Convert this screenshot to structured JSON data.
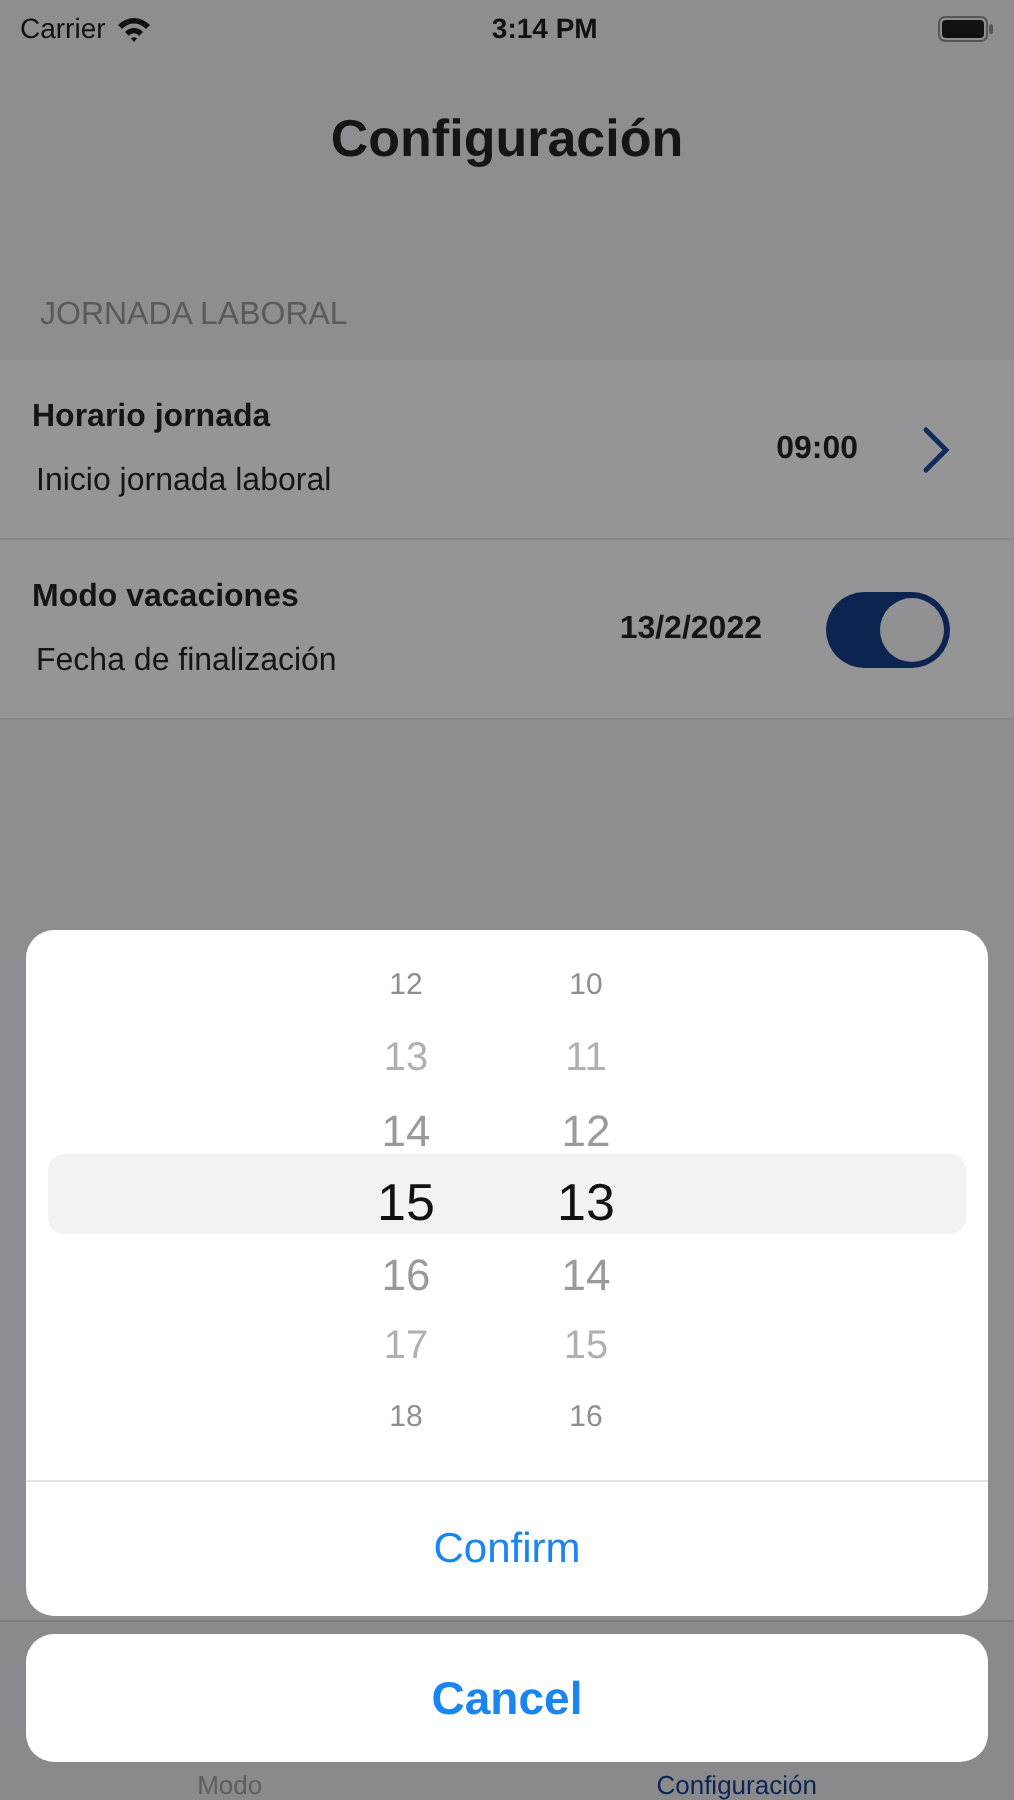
{
  "status_bar": {
    "carrier": "Carrier",
    "time": "3:14 PM"
  },
  "title": "Configuración",
  "section": {
    "header": "JORNADA LABORAL",
    "rows": [
      {
        "kind": "link",
        "title": "Horario jornada",
        "subtitle": "Inicio jornada laboral",
        "value": "09:00"
      },
      {
        "kind": "toggle",
        "title": "Modo vacaciones",
        "subtitle": "Fecha de finalización",
        "value": "13/2/2022",
        "on": true
      }
    ]
  },
  "picker": {
    "columns": [
      {
        "items": [
          {
            "label": "12",
            "selected": false
          },
          {
            "label": "13",
            "selected": false
          },
          {
            "label": "14",
            "selected": false
          },
          {
            "label": "15",
            "selected": true
          },
          {
            "label": "16",
            "selected": false
          },
          {
            "label": "17",
            "selected": false
          },
          {
            "label": "18",
            "selected": false
          }
        ]
      },
      {
        "items": [
          {
            "label": "10",
            "selected": false
          },
          {
            "label": "11",
            "selected": false
          },
          {
            "label": "12",
            "selected": false
          },
          {
            "label": "13",
            "selected": true
          },
          {
            "label": "14",
            "selected": false
          },
          {
            "label": "15",
            "selected": false
          },
          {
            "label": "16",
            "selected": false
          }
        ]
      }
    ],
    "confirm": "Confirm",
    "cancel": "Cancel"
  },
  "tab_bar": [
    {
      "label": "Modo",
      "selected": false
    },
    {
      "label": "Configuración",
      "selected": true
    }
  ]
}
